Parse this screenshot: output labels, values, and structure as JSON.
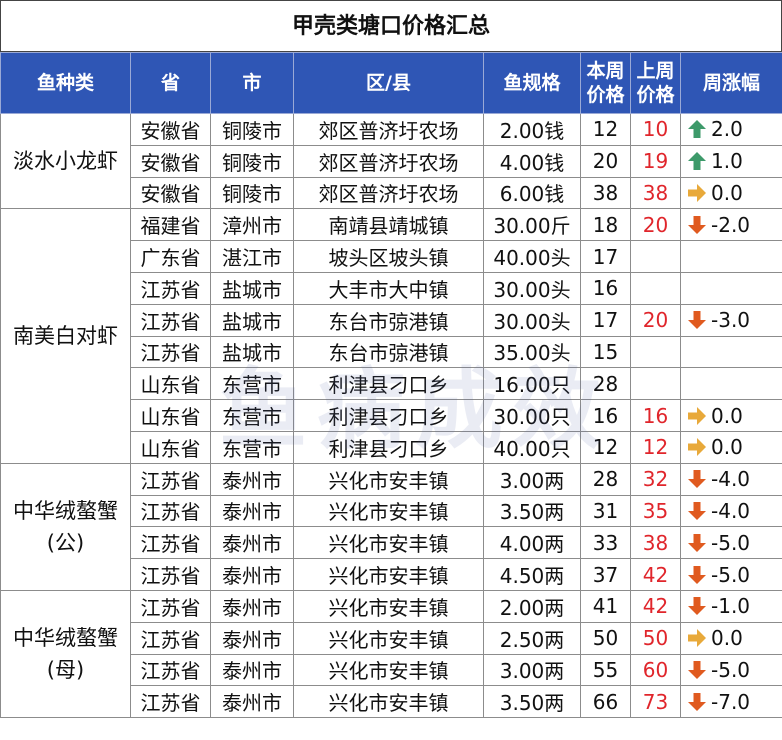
{
  "title": "甲壳类塘口价格汇总",
  "headers": {
    "category": "鱼种类",
    "province": "省",
    "city": "市",
    "district": "区/县",
    "spec": "鱼规格",
    "this_week": [
      "本周",
      "价格"
    ],
    "last_week": [
      "上周",
      "价格"
    ],
    "change": "周涨幅"
  },
  "watermark": "鱼病成效",
  "colors": {
    "header_bg": "#2f56b5",
    "up": "#3d9a6a",
    "down": "#e05a1f",
    "flat": "#e8a93a",
    "last_week_text": "#e0252b"
  },
  "groups": [
    {
      "category": [
        "淡水小龙虾"
      ],
      "rows": [
        {
          "province": "安徽省",
          "city": "铜陵市",
          "district": "郊区普济圩农场",
          "spec": "2.00钱",
          "this_week": "12",
          "last_week": "10",
          "trend": "up",
          "change": "2.0"
        },
        {
          "province": "安徽省",
          "city": "铜陵市",
          "district": "郊区普济圩农场",
          "spec": "4.00钱",
          "this_week": "20",
          "last_week": "19",
          "trend": "up",
          "change": "1.0"
        },
        {
          "province": "安徽省",
          "city": "铜陵市",
          "district": "郊区普济圩农场",
          "spec": "6.00钱",
          "this_week": "38",
          "last_week": "38",
          "trend": "flat",
          "change": "0.0"
        }
      ]
    },
    {
      "category": [
        "南美白对虾"
      ],
      "rows": [
        {
          "province": "福建省",
          "city": "漳州市",
          "district": "南靖县靖城镇",
          "spec": "30.00斤",
          "this_week": "18",
          "last_week": "20",
          "trend": "down",
          "change": "-2.0"
        },
        {
          "province": "广东省",
          "city": "湛江市",
          "district": "坡头区坡头镇",
          "spec": "40.00头",
          "this_week": "17",
          "last_week": "",
          "trend": "",
          "change": ""
        },
        {
          "province": "江苏省",
          "city": "盐城市",
          "district": "大丰市大中镇",
          "spec": "30.00头",
          "this_week": "16",
          "last_week": "",
          "trend": "",
          "change": ""
        },
        {
          "province": "江苏省",
          "city": "盐城市",
          "district": "东台市弶港镇",
          "spec": "30.00头",
          "this_week": "17",
          "last_week": "20",
          "trend": "down",
          "change": "-3.0"
        },
        {
          "province": "江苏省",
          "city": "盐城市",
          "district": "东台市弶港镇",
          "spec": "35.00头",
          "this_week": "15",
          "last_week": "",
          "trend": "",
          "change": ""
        },
        {
          "province": "山东省",
          "city": "东营市",
          "district": "利津县刁口乡",
          "spec": "16.00只",
          "this_week": "28",
          "last_week": "",
          "trend": "",
          "change": ""
        },
        {
          "province": "山东省",
          "city": "东营市",
          "district": "利津县刁口乡",
          "spec": "30.00只",
          "this_week": "16",
          "last_week": "16",
          "trend": "flat",
          "change": "0.0"
        },
        {
          "province": "山东省",
          "city": "东营市",
          "district": "利津县刁口乡",
          "spec": "40.00只",
          "this_week": "12",
          "last_week": "12",
          "trend": "flat",
          "change": "0.0"
        }
      ]
    },
    {
      "category": [
        "中华绒螯蟹",
        "(公)"
      ],
      "rows": [
        {
          "province": "江苏省",
          "city": "泰州市",
          "district": "兴化市安丰镇",
          "spec": "3.00两",
          "this_week": "28",
          "last_week": "32",
          "trend": "down",
          "change": "-4.0"
        },
        {
          "province": "江苏省",
          "city": "泰州市",
          "district": "兴化市安丰镇",
          "spec": "3.50两",
          "this_week": "31",
          "last_week": "35",
          "trend": "down",
          "change": "-4.0"
        },
        {
          "province": "江苏省",
          "city": "泰州市",
          "district": "兴化市安丰镇",
          "spec": "4.00两",
          "this_week": "33",
          "last_week": "38",
          "trend": "down",
          "change": "-5.0"
        },
        {
          "province": "江苏省",
          "city": "泰州市",
          "district": "兴化市安丰镇",
          "spec": "4.50两",
          "this_week": "37",
          "last_week": "42",
          "trend": "down",
          "change": "-5.0"
        }
      ]
    },
    {
      "category": [
        "中华绒螯蟹",
        "(母)"
      ],
      "rows": [
        {
          "province": "江苏省",
          "city": "泰州市",
          "district": "兴化市安丰镇",
          "spec": "2.00两",
          "this_week": "41",
          "last_week": "42",
          "trend": "down",
          "change": "-1.0"
        },
        {
          "province": "江苏省",
          "city": "泰州市",
          "district": "兴化市安丰镇",
          "spec": "2.50两",
          "this_week": "50",
          "last_week": "50",
          "trend": "flat",
          "change": "0.0"
        },
        {
          "province": "江苏省",
          "city": "泰州市",
          "district": "兴化市安丰镇",
          "spec": "3.00两",
          "this_week": "55",
          "last_week": "60",
          "trend": "down",
          "change": "-5.0"
        },
        {
          "province": "江苏省",
          "city": "泰州市",
          "district": "兴化市安丰镇",
          "spec": "3.50两",
          "this_week": "66",
          "last_week": "73",
          "trend": "down",
          "change": "-7.0"
        }
      ]
    }
  ]
}
